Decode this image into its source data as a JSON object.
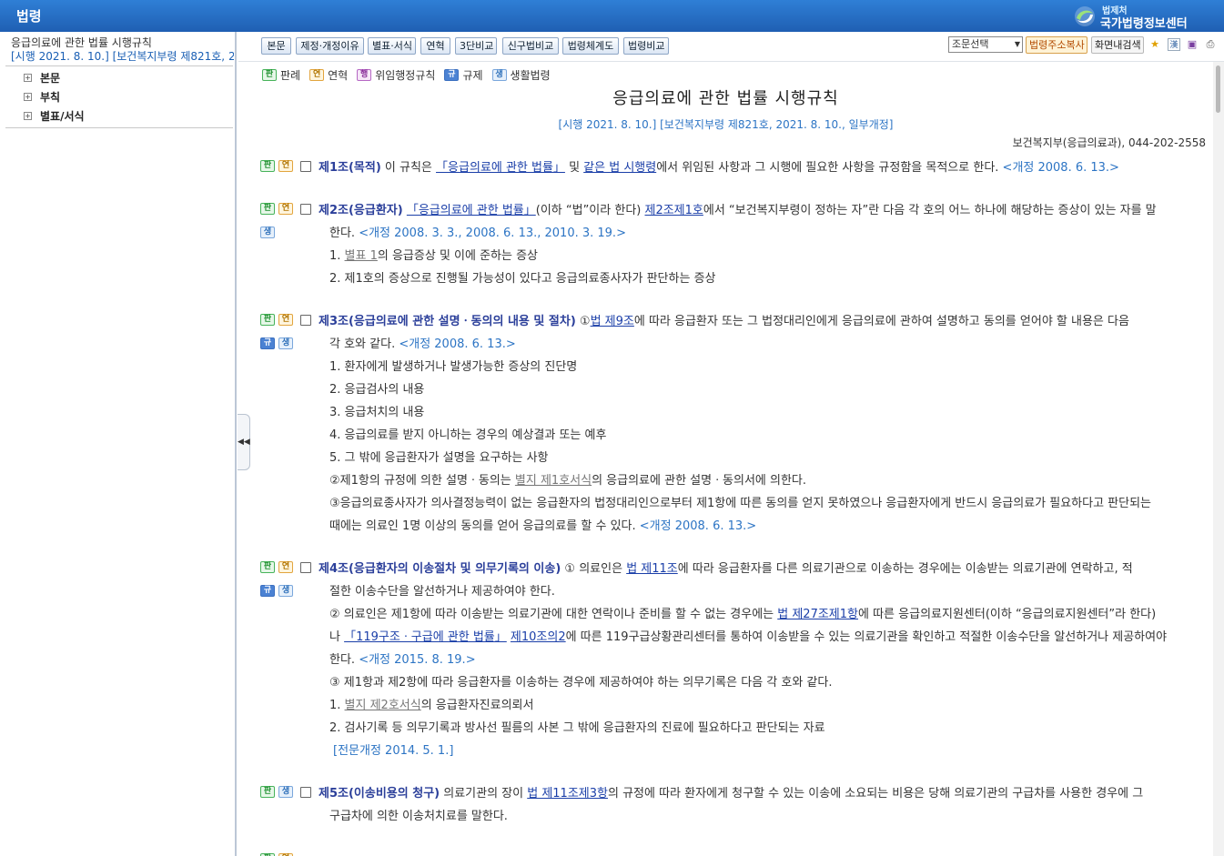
{
  "header": {
    "title": "법령",
    "org_small": "법제처",
    "org": "국가법령정보센터"
  },
  "left": {
    "law_title": "응급의료에 관한 법률 시행규칙",
    "law_sub": "[시행 2021. 8. 10.] [보건복지부령 제821호, 2",
    "tree": [
      "본문",
      "부칙",
      "별표/서식"
    ]
  },
  "toolbar": {
    "buttons": [
      "본문",
      "제정·개정이유",
      "별표·서식",
      "연혁",
      "3단비교",
      "신구법비교",
      "법령체계도",
      "법령비교"
    ],
    "select": "조문선택",
    "copy_url": "법령주소복사",
    "search_in": "화면내검색",
    "hanja": "漢"
  },
  "legend": [
    {
      "badge": "판",
      "label": "판례"
    },
    {
      "badge": "연",
      "label": "연혁"
    },
    {
      "badge": "행",
      "label": "위임행정규칙"
    },
    {
      "badge": "규",
      "label": "규제"
    },
    {
      "badge": "생",
      "label": "생활법령"
    }
  ],
  "doc": {
    "title": "응급의료에 관한 법률 시행규칙",
    "sub": "[시행 2021. 8. 10.] [보건복지부령 제821호, 2021. 8. 10., 일부개정]",
    "dept": "보건복지부(응급의료과), 044-202-2558"
  },
  "articles": {
    "a1": {
      "head": "제1조(목적)",
      "t1": " 이 규칙은 ",
      "l1": "「응급의료에 관한 법률」",
      "t2": " 및 ",
      "l2": "같은 법 시행령",
      "t3": "에서 위임된 사항과 그 시행에 필요한 사항을 규정함을 목적으로 한다. ",
      "rev": "<개정 2008. 6. 13.>"
    },
    "a2": {
      "head": "제2조(응급환자)",
      "l1": "「응급의료에 관한 법률」",
      "t1": "(이하 “법”이라 한다) ",
      "l2": "제2조제1호",
      "t2": "에서 “보건복지부령이 정하는 자”란 다음 각 호의 어느 하나에 해당하는 증상이 있는 자를 말",
      "t3": "한다. ",
      "rev": "<개정 2008. 3. 3., 2008. 6. 13., 2010. 3. 19.>",
      "i1a": "1. ",
      "i1l": "별표 1",
      "i1b": "의 응급증상 및 이에 준하는 증상",
      "i2": "2. 제1호의 증상으로 진행될 가능성이 있다고 응급의료종사자가 판단하는 증상"
    },
    "a3": {
      "head": "제3조(응급의료에 관한 설명ㆍ동의의 내용 및 절차)",
      "t1": " ①",
      "l1": "법 제9조",
      "t2": "에 따라 응급환자 또는 그 법정대리인에게 응급의료에 관하여 설명하고 동의를 얻어야 할 내용은 다음",
      "t3": "각 호와 같다. ",
      "rev": "<개정 2008. 6. 13.>",
      "items": [
        "1. 환자에게 발생하거나 발생가능한 증상의 진단명",
        "2. 응급검사의 내용",
        "3. 응급처치의 내용",
        "4. 응급의료를 받지 아니하는 경우의 예상결과 또는 예후",
        "5. 그 밖에 응급환자가 설명을 요구하는 사항"
      ],
      "p2a": "②제1항의 규정에 의한 설명ㆍ동의는 ",
      "p2l": "별지 제1호서식",
      "p2b": "의 응급의료에 관한 설명ㆍ동의서에 의한다.",
      "p3a": "③응급의료종사자가 의사결정능력이 없는 응급환자의 법정대리인으로부터 제1항에 따른 동의를 얻지 못하였으나 응급환자에게 반드시 응급의료가 필요하다고 판단되는",
      "p3b": "때에는 의료인 1명 이상의 동의를 얻어 응급의료를 할 수 있다. ",
      "p3rev": "<개정 2008. 6. 13.>"
    },
    "a4": {
      "head": "제4조(응급환자의 이송절차 및 의무기록의 이송)",
      "t1": " ① 의료인은 ",
      "l1": "법 제11조",
      "t2": "에 따라 응급환자를 다른 의료기관으로 이송하는 경우에는 이송받는 의료기관에 연락하고, 적",
      "t3": "절한 이송수단을 알선하거나 제공하여야 한다.",
      "p2a": "② 의료인은 제1항에 따라 이송받는 의료기관에 대한 연락이나 준비를 할 수 없는 경우에는 ",
      "p2l": "법 제27조제1항",
      "p2b": "에 따른 응급의료지원센터(이하 “응급의료지원센터”라 한다)",
      "p2c": "나 ",
      "p2l2": "「119구조ㆍ구급에 관한 법률」",
      "p2d": " ",
      "p2l3": "제10조의2",
      "p2e": "에 따른 119구급상황관리센터를 통하여 이송받을 수 있는 의료기관을 확인하고 적절한 이송수단을 알선하거나 제공하여야",
      "p2f": "한다. ",
      "p2rev": "<개정 2015. 8. 19.>",
      "p3": "③ 제1항과 제2항에 따라 응급환자를 이송하는 경우에 제공하여야 하는 의무기록은 다음 각 호와 같다.",
      "i1a": "1. ",
      "i1l": "별지 제2호서식",
      "i1b": "의 응급환자진료의뢰서",
      "i2": "2. 검사기록 등 의무기록과 방사선 필름의 사본 그 밖에 응급환자의 진료에 필요하다고 판단되는 자료",
      "full_rev": "[전문개정 2014. 5. 1.]"
    },
    "a5": {
      "head": "제5조(이송비용의 청구)",
      "t1": " 의료기관의 장이 ",
      "l1": "법 제11조제3항",
      "t2": "의 규정에 따라 환자에게 청구할 수 있는 이송에 소요되는 비용은 당해 의료기관의 구급차를 사용한 경우에 그",
      "t3": "구급차에 의한 이송처치료를 말한다."
    }
  }
}
